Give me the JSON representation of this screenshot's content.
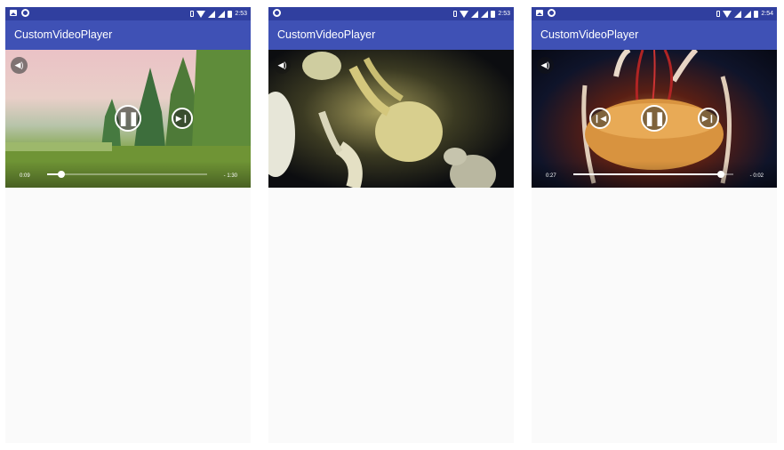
{
  "app": {
    "title": "CustomVideoPlayer"
  },
  "colors": {
    "status_bar": "#303f9f",
    "app_bar": "#3f51b5",
    "content_bg": "#fafafa"
  },
  "screens": [
    {
      "status": {
        "time": "2:53"
      },
      "video": {
        "scene": "meadow-with-trees",
        "playing": true,
        "current_time": "0:09",
        "remaining_time": "- 1:30",
        "progress": 0.09,
        "controls_visible": true
      }
    },
    {
      "status": {
        "time": "2:53"
      },
      "video": {
        "scene": "moon-jellyfish",
        "playing": true,
        "controls_visible": false
      }
    },
    {
      "status": {
        "time": "2:54"
      },
      "video": {
        "scene": "sea-nettle-jellyfish",
        "playing": true,
        "current_time": "0:27",
        "remaining_time": "- 0:02",
        "progress": 0.92,
        "controls_visible": true
      }
    }
  ]
}
